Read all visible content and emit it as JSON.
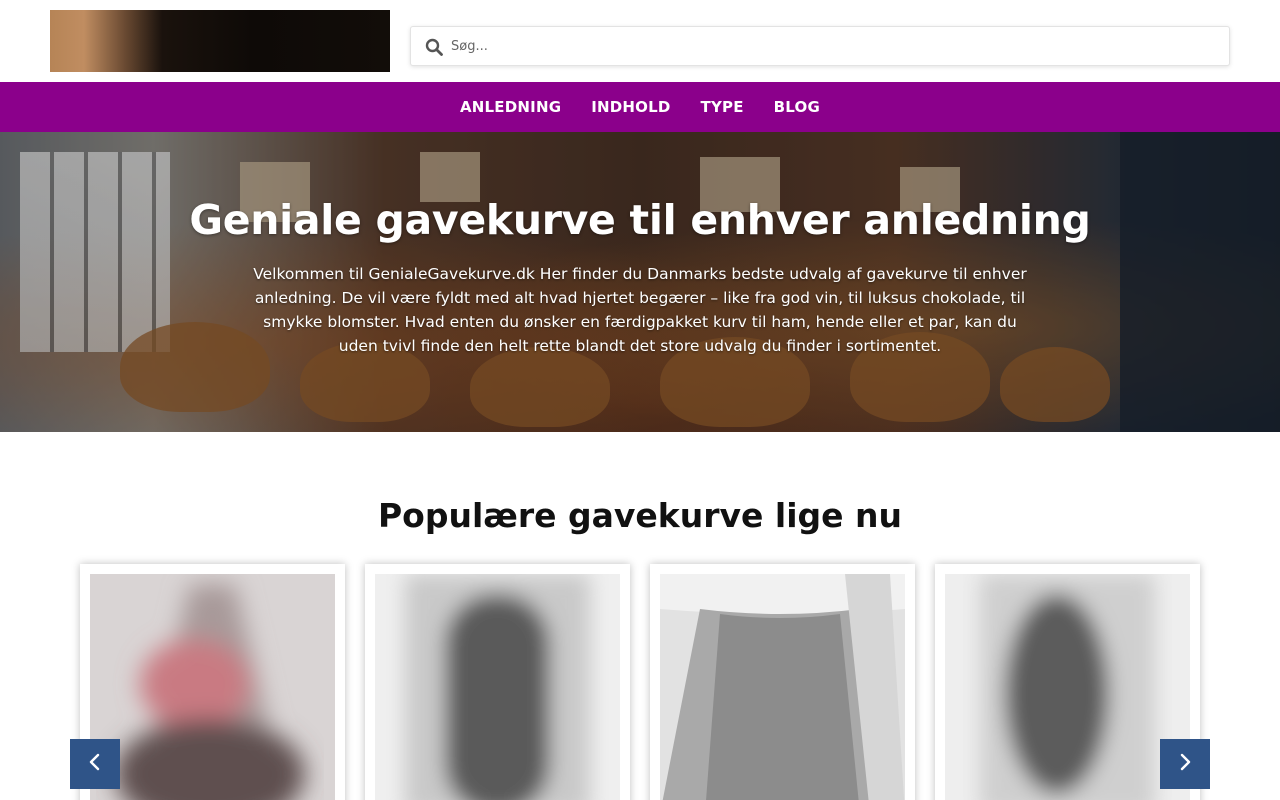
{
  "search": {
    "placeholder": "Søg..."
  },
  "nav": {
    "items": [
      {
        "label": "ANLEDNING"
      },
      {
        "label": "INDHOLD"
      },
      {
        "label": "TYPE"
      },
      {
        "label": "BLOG"
      }
    ]
  },
  "hero": {
    "title": "Geniale gavekurve til enhver anledning",
    "text": "Velkommen til GenialeGavekurve.dk Her finder du Danmarks bedste udvalg af gavekurve til enhver anledning. De vil være fyldt med alt hvad hjertet begærer – like fra god vin, til luksus chokolade, til smykke blomster. Hvad enten du ønsker en færdigpakket kurv til ham, hende eller et par, kan du uden tvivl finde den helt rette blandt det store udvalg du finder i sortimentet."
  },
  "popular": {
    "title": "Populære gavekurve lige nu"
  },
  "colors": {
    "nav_bg": "#8b008b",
    "arrow_bg": "#2f5488"
  },
  "icons": {
    "search": "search-icon",
    "prev": "chevron-left-icon",
    "next": "chevron-right-icon"
  }
}
